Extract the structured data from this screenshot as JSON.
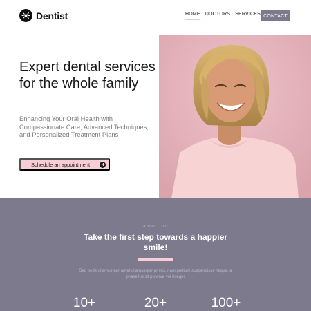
{
  "header": {
    "brand": "Dentist",
    "nav": [
      "HOME",
      "DOCTORS",
      "SERVICES"
    ],
    "contact_label": "CONTACT"
  },
  "hero": {
    "title": "Expert dental services for the whole family",
    "subtitle": "Enhancing Your Oral Health with Compassionate Care, Advanced Techniques, and Personalized Treatment Plans",
    "cta_label": "Schedule an appointment"
  },
  "about": {
    "eyebrow": "ABOUT US",
    "title": "Take the first step towards a happier smile!",
    "text": "Sed pede ullamcorper amet ullamcorper primis, nam pretium suspendisse neque, a phasellus sit pulvinar vel integer",
    "stats": [
      "10+",
      "20+",
      "100+"
    ]
  },
  "colors": {
    "accent": "#7d7a8e",
    "pink": "#f7ced5",
    "hero_bg": "#e7b4bd"
  }
}
